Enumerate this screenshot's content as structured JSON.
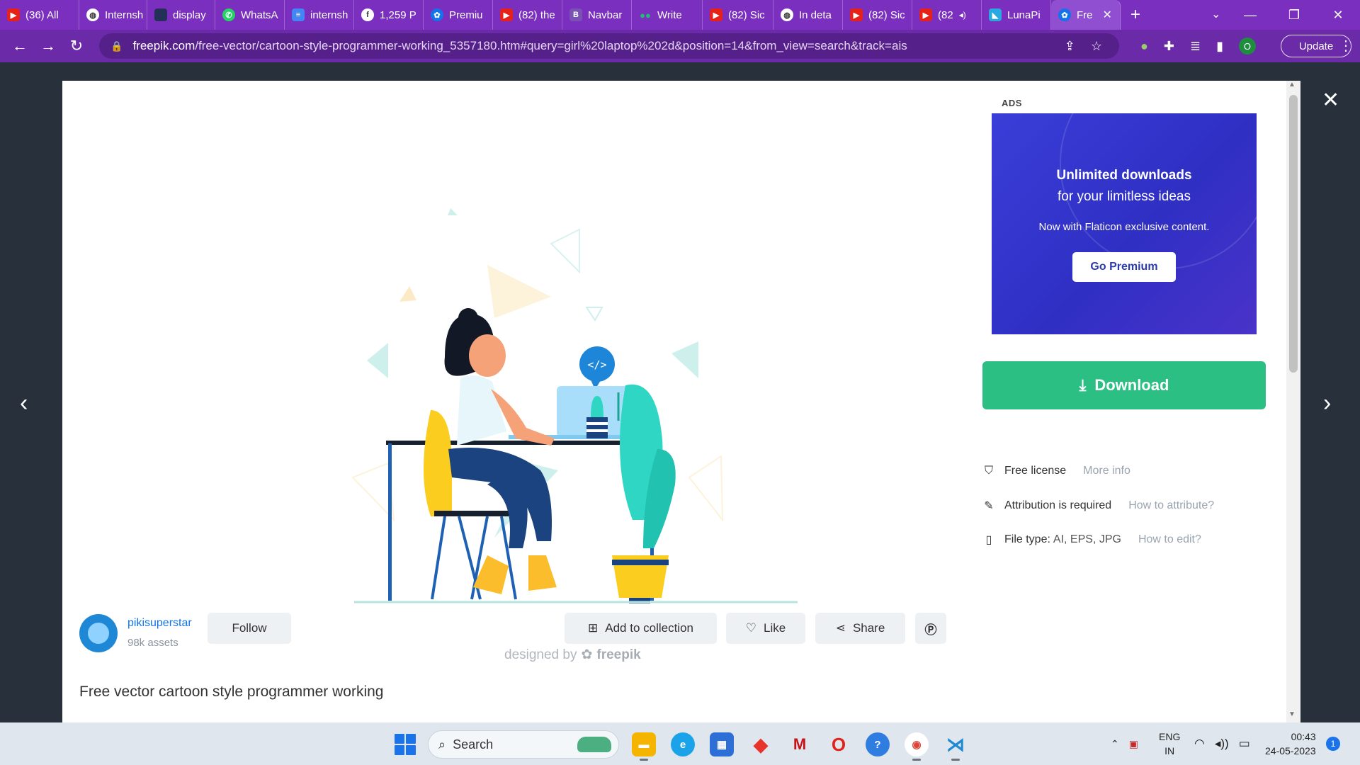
{
  "browser": {
    "tabs": [
      {
        "favicon": "youtube-icon",
        "label": "(36) All"
      },
      {
        "favicon": "globe-icon",
        "label": "Internsh"
      },
      {
        "favicon": "blank-icon",
        "label": "display"
      },
      {
        "favicon": "whatsapp-icon",
        "label": "WhatsA"
      },
      {
        "favicon": "docs-icon",
        "label": "internsh"
      },
      {
        "favicon": "facebook-icon",
        "label": "1,259 P"
      },
      {
        "favicon": "freepik-icon",
        "label": "Premiu"
      },
      {
        "favicon": "youtube-icon",
        "label": "(82) the"
      },
      {
        "favicon": "bootstrap-icon",
        "label": "Navbar"
      },
      {
        "favicon": "medium-icon",
        "label": "Write"
      },
      {
        "favicon": "youtube-icon",
        "label": "(82) Sic"
      },
      {
        "favicon": "globe-icon",
        "label": "In deta"
      },
      {
        "favicon": "youtube-icon",
        "label": "(82) Sic"
      },
      {
        "favicon": "youtube-icon",
        "label": "(82"
      },
      {
        "favicon": "lunapic-icon",
        "label": "LunaPi"
      },
      {
        "favicon": "freepik-icon",
        "label": "Fre"
      }
    ],
    "url_host": "freepik.com",
    "url_path": "/free-vector/cartoon-style-programmer-working_5357180.htm#query=girl%20laptop%202d&position=14&from_view=search&track=ais",
    "profile_initial": "O",
    "update_label": "Update"
  },
  "modal": {
    "ads_label": "ADS",
    "ad": {
      "title": "Unlimited downloads",
      "subtitle": "for your limitless ideas",
      "note": "Now with Flaticon exclusive content.",
      "button": "Go Premium"
    },
    "download_label": "Download",
    "info": {
      "license": "Free license",
      "license_link": "More info",
      "attribution": "Attribution is required",
      "attribution_link": "How to attribute?",
      "filetype_label": "File type:",
      "filetype_value": "AI, EPS, JPG",
      "filetype_link": "How to edit?"
    },
    "credit_prefix": "designed by",
    "credit_brand": "freepik",
    "author": {
      "name": "pikisuperstar",
      "assets": "98k assets"
    },
    "follow_label": "Follow",
    "actions": {
      "add_collection": "Add to collection",
      "like": "Like",
      "share": "Share"
    },
    "title": "Free vector cartoon style programmer working"
  },
  "taskbar": {
    "search_label": "Search",
    "lang_top": "ENG",
    "lang_bottom": "IN",
    "time": "00:43",
    "date": "24-05-2023",
    "notifications": "1"
  },
  "colors": {
    "chrome_purple": "#7b2fbe",
    "download_green": "#2cbf84",
    "link_blue": "#1273eb",
    "ad_blue": "#3a3ed8"
  }
}
